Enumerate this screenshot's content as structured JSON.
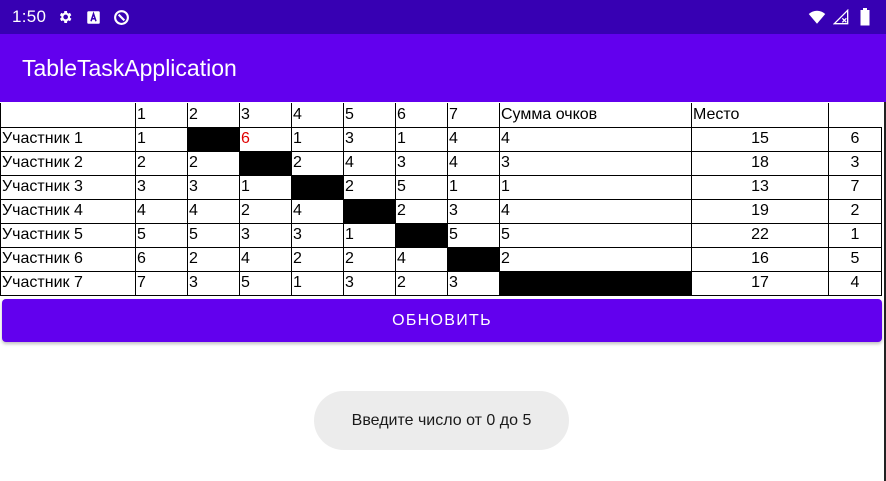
{
  "status_bar": {
    "time": "1:50",
    "icons": [
      "settings-icon",
      "a-badge-icon",
      "sync-icon"
    ],
    "right_icons": [
      "wifi-icon",
      "signal-icon",
      "battery-icon"
    ],
    "bg_color": "#3700B3"
  },
  "app_bar": {
    "title": "TableTaskApplication",
    "bg_color": "#6200EE"
  },
  "table": {
    "headers": [
      "",
      "1",
      "2",
      "3",
      "4",
      "5",
      "6",
      "7",
      "Сумма очков",
      "Место"
    ],
    "rows": [
      {
        "name": "Участник 1",
        "scores": [
          "1",
          "",
          "6",
          "1",
          "3",
          "1",
          "4",
          "4"
        ],
        "sum": "15",
        "place": "6"
      },
      {
        "name": "Участник 2",
        "scores": [
          "2",
          "2",
          "",
          "2",
          "4",
          "3",
          "4",
          "3"
        ],
        "sum": "18",
        "place": "3"
      },
      {
        "name": "Участник 3",
        "scores": [
          "3",
          "3",
          "1",
          "",
          "2",
          "5",
          "1",
          "1"
        ],
        "sum": "13",
        "place": "7"
      },
      {
        "name": "Участник 4",
        "scores": [
          "4",
          "4",
          "2",
          "4",
          "",
          "2",
          "3",
          "4"
        ],
        "sum": "19",
        "place": "2"
      },
      {
        "name": "Участник 5",
        "scores": [
          "5",
          "5",
          "3",
          "3",
          "1",
          "",
          "5",
          "5"
        ],
        "sum": "22",
        "place": "1"
      },
      {
        "name": "Участник 6",
        "scores": [
          "6",
          "2",
          "4",
          "2",
          "2",
          "4",
          "",
          "2"
        ],
        "sum": "16",
        "place": "5"
      },
      {
        "name": "Участник 7",
        "scores": [
          "7",
          "3",
          "5",
          "1",
          "3",
          "2",
          "3",
          ""
        ],
        "sum": "17",
        "place": "4"
      }
    ],
    "highlight_color": "#e00000",
    "diagonal_color": "#000000"
  },
  "button": {
    "label": "ОБНОВИТЬ"
  },
  "toast": {
    "message": "Введите число от 0 до 5"
  }
}
